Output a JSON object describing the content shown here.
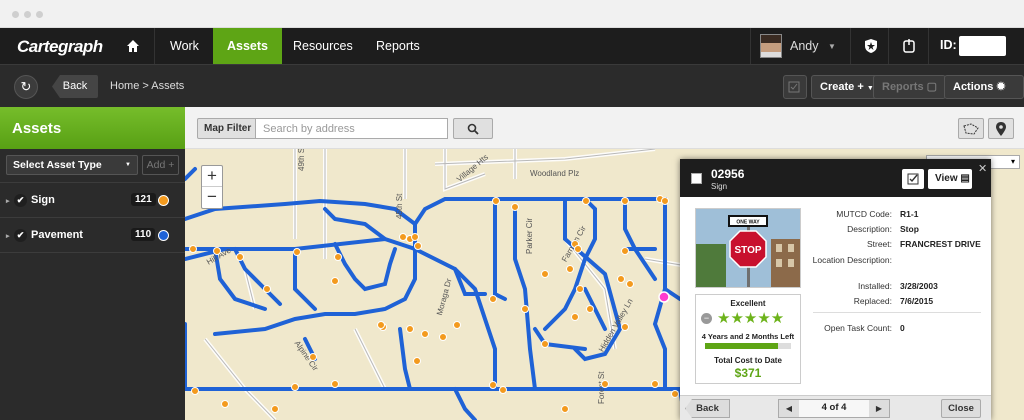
{
  "app": {
    "logo": "Cartegraph"
  },
  "nav": {
    "items": [
      {
        "label": "Work"
      },
      {
        "label": "Assets"
      },
      {
        "label": "Resources"
      },
      {
        "label": "Reports"
      }
    ],
    "active": "Assets",
    "user": "Andy",
    "id_label": "ID:"
  },
  "toolbar": {
    "back": "Back",
    "breadcrumb": "Home  >  Assets",
    "create": "Create",
    "reports": "Reports",
    "actions": "Actions"
  },
  "sidebar": {
    "title": "Assets",
    "asset_type_select": "Select Asset Type",
    "add": "Add",
    "layers": [
      {
        "label": "Sign",
        "count": "121",
        "color": "#f39a1e"
      },
      {
        "label": "Pavement",
        "count": "110",
        "color": "#1f62d6"
      }
    ]
  },
  "mapbar": {
    "map_filter": "Map Filter",
    "search_placeholder": "Search by address"
  },
  "map": {
    "street_labels": [
      "49th St",
      "45th St",
      "Village Hts",
      "Woodland Plz",
      "Hill Ave",
      "Alpine Cir",
      "Parker Cir",
      "Farnam Cir",
      "Moraga Dr",
      "Hidden Valley Ln",
      "Forest St"
    ],
    "road_color": "#1f62d6",
    "marker_color": "#f39a1e",
    "selected_marker_color": "#ff3ccf"
  },
  "popup": {
    "id": "02956",
    "type": "Sign",
    "view": "View",
    "rating": {
      "label": "Excellent",
      "stars_text": "★★★★★",
      "remaining": "4 Years and 2 Months Left",
      "remaining_fraction": 0.85,
      "cost_label": "Total Cost to Date",
      "cost": "$371"
    },
    "fields": [
      {
        "label": "MUTCD Code:",
        "value": "R1-1"
      },
      {
        "label": "Description:",
        "value": "Stop"
      },
      {
        "label": "Street:",
        "value": "FRANCREST DRIVE"
      },
      {
        "label": "Location Description:",
        "value": ""
      },
      {
        "label": "Installed:",
        "value": "3/28/2003"
      },
      {
        "label": "Replaced:",
        "value": "7/6/2015"
      },
      {
        "label": "Open Task Count:",
        "value": "0"
      }
    ],
    "footer": {
      "back": "Back",
      "pager": "4 of 4",
      "close": "Close"
    },
    "photo": {
      "one_way_text": "ONE WAY",
      "stop_text": "STOP"
    }
  }
}
